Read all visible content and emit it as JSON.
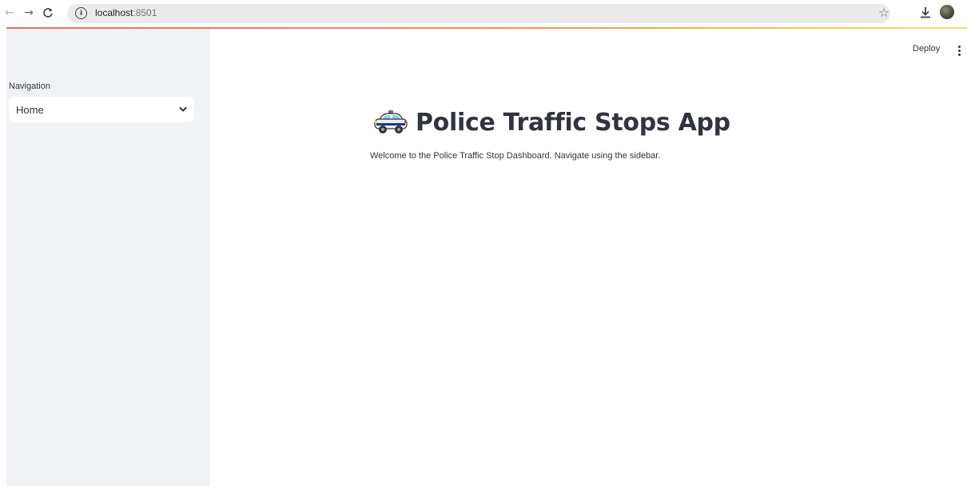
{
  "browser": {
    "url_host": "localhost",
    "url_port": ":8501"
  },
  "sidebar": {
    "nav_label": "Navigation",
    "select_value": "Home"
  },
  "header": {
    "deploy_label": "Deploy"
  },
  "main": {
    "title": "Police Traffic Stops App",
    "title_icon": "police-car-icon",
    "welcome": "Welcome to the Police Traffic Stop Dashboard. Navigate using the sidebar."
  },
  "colors": {
    "sidebar_bg": "#f0f2f6",
    "text": "#31333f",
    "header_gradient_start": "#f3665e",
    "header_gradient_end": "#f9dd72"
  }
}
